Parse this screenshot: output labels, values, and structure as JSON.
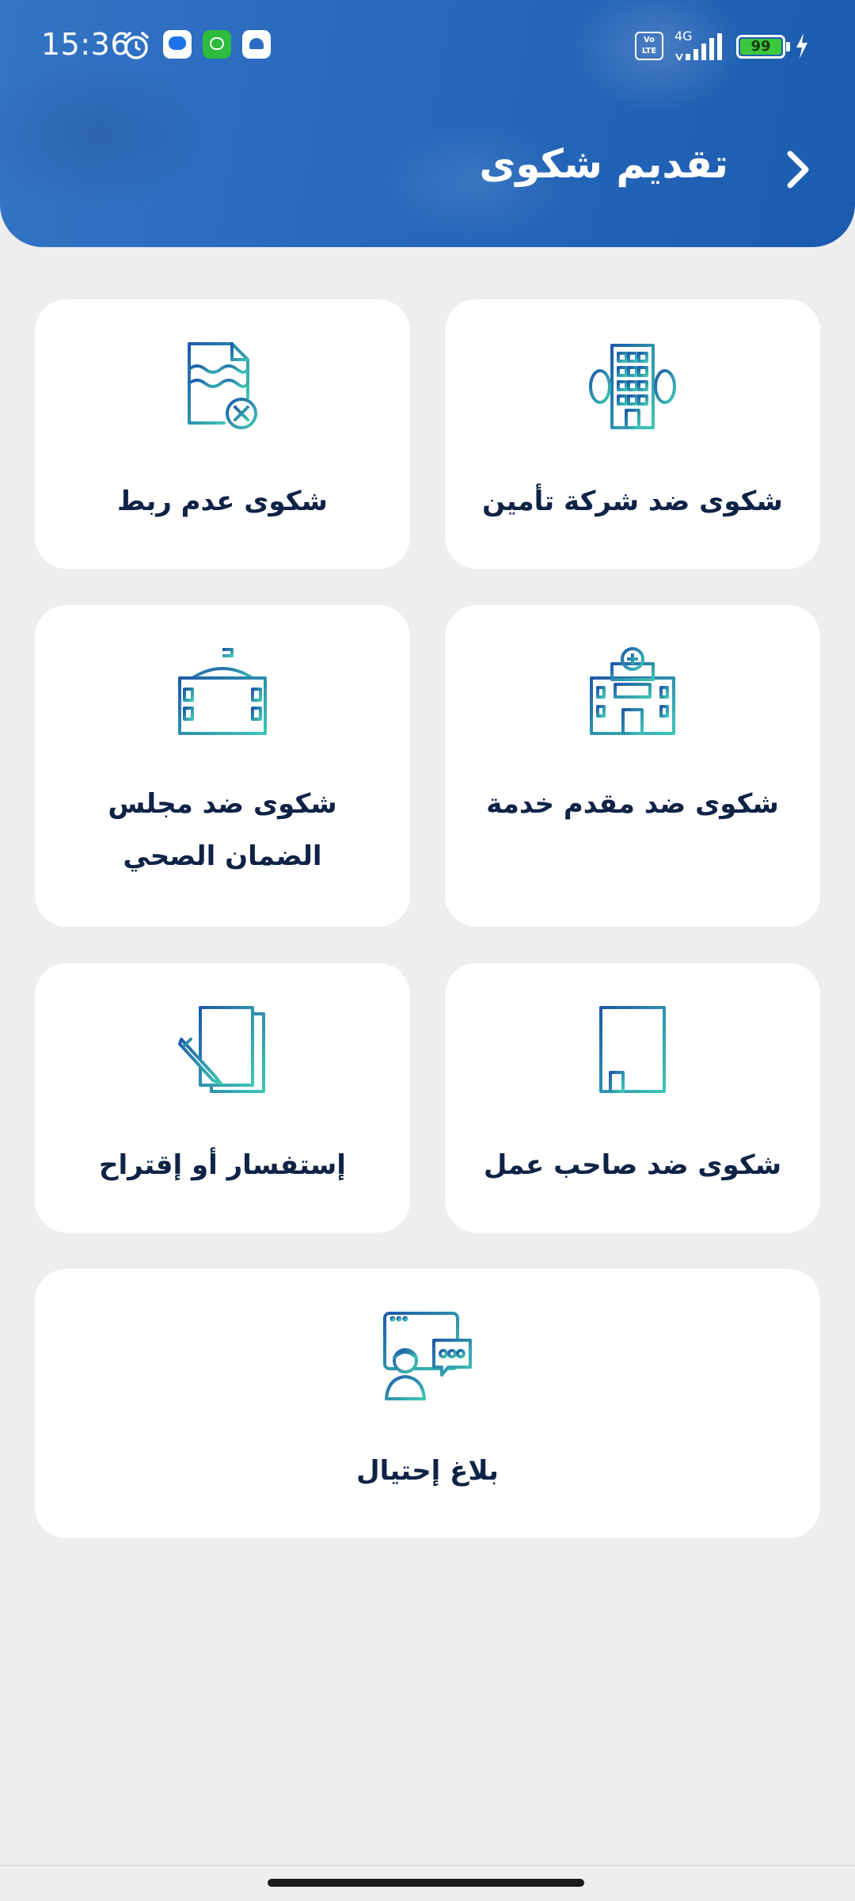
{
  "status_bar": {
    "time": "15:36",
    "network": "4G",
    "volte": "Vo LTE",
    "battery": "99"
  },
  "header": {
    "title": "تقديم شكوى",
    "back_icon": "chevron-right-icon"
  },
  "colors": {
    "header_blue": "#2364b7",
    "card_text": "#0f2346",
    "icon_gradient_start": "#1e5aa8",
    "icon_gradient_end": "#3fc6b4",
    "background": "#eeeeee"
  },
  "cards": [
    {
      "label": "شكوى ضد شركة تأمين",
      "icon": "office-building-icon"
    },
    {
      "label": "شكوى عدم ربط",
      "icon": "document-x-icon"
    },
    {
      "label": "شكوى ضد مقدم خدمة",
      "icon": "hospital-icon"
    },
    {
      "label_line1": "شكوى ضد مجلس",
      "label_line2": "الضمان الصحي",
      "icon": "government-building-icon"
    },
    {
      "label": "شكوى ضد صاحب عمل",
      "icon": "workplace-building-icon"
    },
    {
      "label": "إستفسار أو إقتراح",
      "icon": "document-pencil-icon"
    },
    {
      "label": "بلاغ إحتيال",
      "icon": "fraud-report-icon"
    }
  ]
}
